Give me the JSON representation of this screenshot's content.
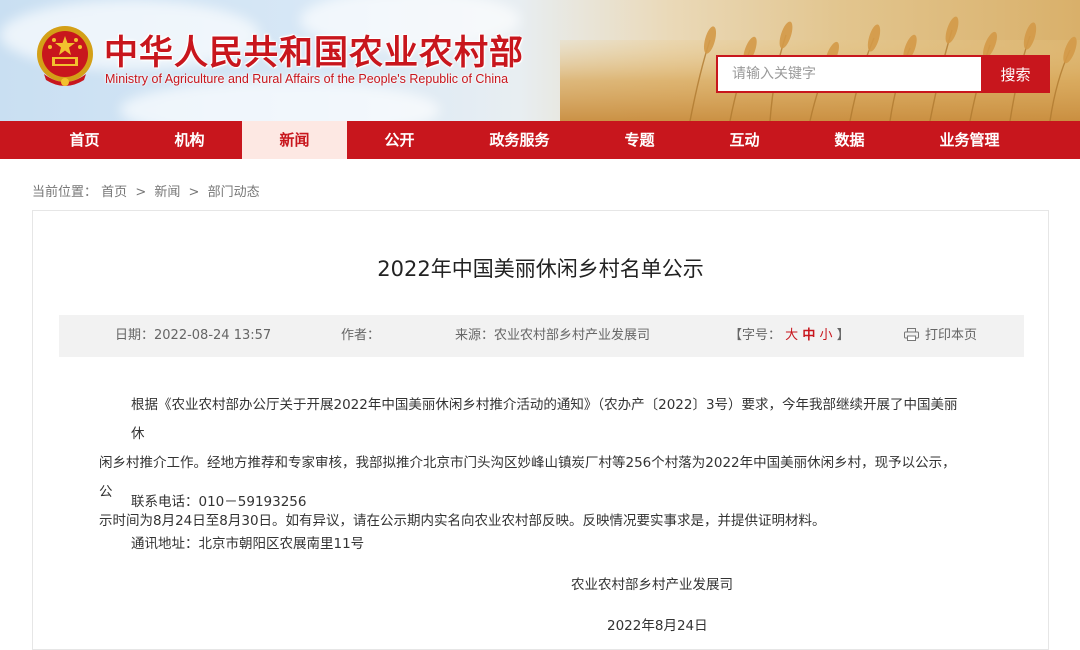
{
  "header": {
    "title_cn": "中华人民共和国农业农村部",
    "title_en": "Ministry of Agriculture and Rural Affairs of the People's Republic of China",
    "search": {
      "placeholder": "请输入关键字",
      "button_label": "搜索"
    }
  },
  "nav": {
    "items": [
      {
        "label": "首页"
      },
      {
        "label": "机构"
      },
      {
        "label": "新闻"
      },
      {
        "label": "公开"
      },
      {
        "label": "政务服务"
      },
      {
        "label": "专题"
      },
      {
        "label": "互动"
      },
      {
        "label": "数据"
      },
      {
        "label": "业务管理"
      }
    ],
    "active": "新闻"
  },
  "breadcrumb": {
    "prefix": "当前位置：",
    "items": [
      "首页",
      "新闻",
      "部门动态"
    ],
    "separator": ">"
  },
  "article": {
    "title": "2022年中国美丽休闲乡村名单公示",
    "meta": {
      "date_label": "日期：",
      "date": "2022-08-24 13:57",
      "author_label": "作者：",
      "author": "",
      "source_label": "来源：",
      "source": "农业农村部乡村产业发展司",
      "font_size_label": "【字号：",
      "font_big": "大",
      "font_mid": "中",
      "font_small": "小",
      "font_size_close": "】",
      "print_label": "打印本页"
    },
    "body_lines": [
      "根据《农业农村部办公厅关于开展2022年中国美丽休闲乡村推介活动的通知》（农办产〔2022〕3号）要求，今年我部继续开展了中国美丽休",
      "闲乡村推介工作。经地方推荐和专家审核，我部拟推介北京市门头沟区妙峰山镇炭厂村等256个村落为2022年中国美丽休闲乡村，现予以公示，公",
      "示时间为8月24日至8月30日。如有异议，请在公示期内实名向农业农村部反映。反映情况要实事求是，并提供证明材料。"
    ],
    "phone_label": "联系电话：",
    "phone": "010－59193256",
    "address_label": "通讯地址：",
    "address": "北京市朝阳区农展南里11号",
    "signature": "农业农村部乡村产业发展司",
    "sign_date": "2022年8月24日"
  },
  "colors": {
    "brand_red": "#c8161d",
    "nav_active_bg": "#fde8e3",
    "meta_bg": "#f2f2f2"
  }
}
